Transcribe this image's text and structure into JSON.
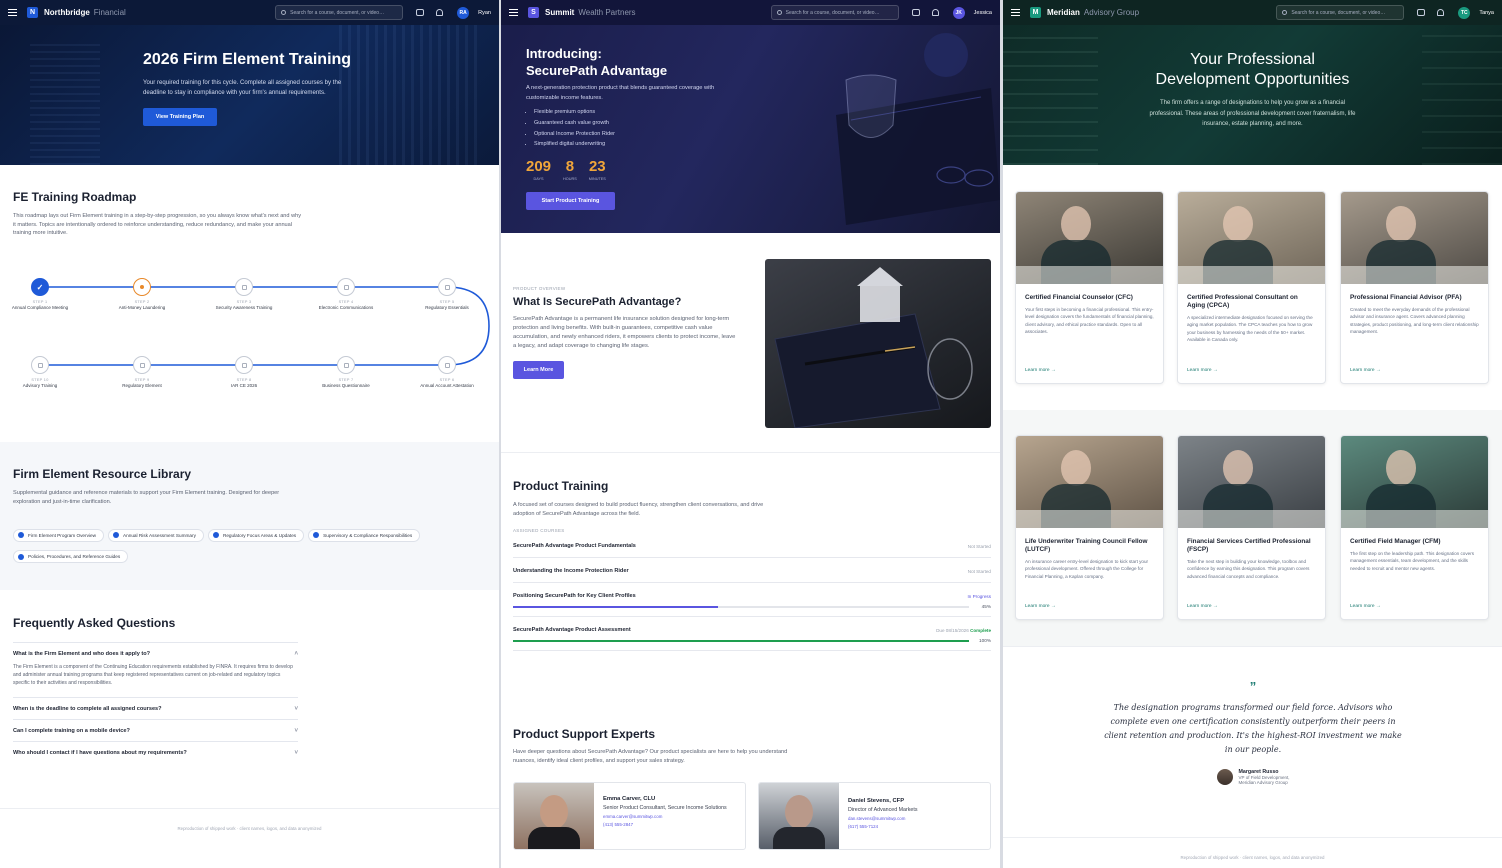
{
  "p1": {
    "topbar": {
      "logo": "N",
      "brand": "Northbridge",
      "brand_sub": "Financial",
      "search_placeholder": "Search for a course, document, or video…",
      "avatar": "RA",
      "user": "Ryan"
    },
    "hero": {
      "title": "2026 Firm Element Training",
      "text": "Your required training for this cycle. Complete all assigned courses by the deadline to stay in compliance with your firm's annual requirements.",
      "button": "View Training Plan"
    },
    "roadmap": {
      "title": "FE Training Roadmap",
      "text": "This roadmap lays out Firm Element training in a step-by-step progression, so you always know what's next and why it matters. Topics are intentionally ordered to reinforce understanding, reduce redundancy, and make your annual training more intuitive.",
      "steps": [
        {
          "step": "STEP 1",
          "name": "Annual Compliance Meeting",
          "status": "complete"
        },
        {
          "step": "STEP 2",
          "name": "Anti-Money Laundering",
          "status": "current"
        },
        {
          "step": "STEP 3",
          "name": "Security Awareness Training",
          "status": "locked"
        },
        {
          "step": "STEP 4",
          "name": "Electronic Communications",
          "status": "locked"
        },
        {
          "step": "STEP 5",
          "name": "Regulatory Essentials",
          "status": "locked"
        },
        {
          "step": "STEP 6",
          "name": "Annual Account Attestation",
          "status": "locked"
        },
        {
          "step": "STEP 7",
          "name": "Business Questionnaire",
          "status": "locked"
        },
        {
          "step": "STEP 8",
          "name": "IAR CE 2026",
          "status": "locked"
        },
        {
          "step": "STEP 9",
          "name": "Regulatory Element",
          "status": "locked"
        },
        {
          "step": "STEP 10",
          "name": "Advisory Training",
          "status": "locked"
        }
      ]
    },
    "library": {
      "title": "Firm Element Resource Library",
      "text": "Supplemental guidance and reference materials to support your Firm Element training. Designed for deeper exploration and just-in-time clarification.",
      "items": [
        "Firm Element Program Overview",
        "Annual Risk Assessment Summary",
        "Regulatory Focus Areas & Updates",
        "Supervisory & Compliance Responsibilities",
        "Policies, Procedures, and Reference Guides"
      ]
    },
    "faq": {
      "title": "Frequently Asked Questions",
      "items": [
        {
          "q": "What is the Firm Element and who does it apply to?",
          "a": "The Firm Element is a component of the Continuing Education requirements established by FINRA. It requires firms to develop and administer annual training programs that keep registered representatives current on job-related and regulatory topics specific to their activities and responsibilities."
        },
        {
          "q": "When is the deadline to complete all assigned courses?"
        },
        {
          "q": "Can I complete training on a mobile device?"
        },
        {
          "q": "Who should I contact if I have questions about my requirements?"
        }
      ]
    },
    "footer": "Reproduction of shipped work · client names, logos, and data anonymized"
  },
  "p2": {
    "topbar": {
      "logo": "S",
      "brand": "Summit",
      "brand_sub": "Wealth Partners",
      "search_placeholder": "Search for a course, document, or video…",
      "avatar": "JK",
      "user": "Jessica"
    },
    "hero": {
      "title_1": "Introducing:",
      "title_2": "SecurePath Advantage",
      "text": "A next-generation protection product that blends guaranteed coverage with customizable income features.",
      "bullets": [
        "Flexible premium options",
        "Guaranteed cash value growth",
        "Optional Income Protection Rider",
        "Simplified digital underwriting"
      ],
      "countdown": [
        {
          "value": "209",
          "label": "DAYS"
        },
        {
          "value": "8",
          "label": "HOURS"
        },
        {
          "value": "23",
          "label": "MINUTES"
        }
      ],
      "button": "Start Product Training"
    },
    "overview": {
      "eyebrow": "PRODUCT OVERVIEW",
      "title": "What Is SecurePath Advantage?",
      "text": "SecurePath Advantage is a permanent life insurance solution designed for long-term protection and living benefits. With built-in guarantees, competitive cash value accumulation, and newly enhanced riders, it empowers clients to protect income, leave a legacy, and adapt coverage to changing life stages.",
      "button": "Learn More"
    },
    "training": {
      "title": "Product Training",
      "text": "A focused set of courses designed to build product fluency, strengthen client conversations, and drive adoption of SecurePath Advantage across the field.",
      "label": "ASSIGNED COURSES",
      "courses": [
        {
          "name": "SecurePath Advantage Product Fundamentals",
          "status": "Not Started"
        },
        {
          "name": "Understanding the Income Protection Rider",
          "status": "Not Started"
        },
        {
          "name": "Positioning SecurePath for Key Client Profiles",
          "status": "In Progress",
          "progress": 45,
          "pct": "45%"
        },
        {
          "name": "SecurePath Advantage Product Assessment",
          "due": "Due 08/15/2026",
          "status": "Complete",
          "progress": 100,
          "pct": "100%"
        }
      ]
    },
    "experts": {
      "title": "Product Support Experts",
      "text": "Have deeper questions about SecurePath Advantage? Our product specialists are here to help you understand nuances, identify ideal client profiles, and support your sales strategy.",
      "people": [
        {
          "name": "Emma Carver, CLU",
          "role": "Senior Product Consultant, Secure Income Solutions",
          "email": "emma.carver@summitwp.com",
          "phone": "(413) 555-2847"
        },
        {
          "name": "Daniel Stevens, CFP",
          "role": "Director of Advanced Markets",
          "email": "dan.stevens@summitwp.com",
          "phone": "(617) 555-7124"
        }
      ]
    }
  },
  "p3": {
    "topbar": {
      "logo": "M",
      "brand": "Meridian",
      "brand_sub": "Advisory Group",
      "search_placeholder": "Search for a course, document, or video…",
      "avatar": "TC",
      "user": "Tanya"
    },
    "hero": {
      "title_1": "Your Professional",
      "title_2": "Development Opportunities",
      "text": "The firm offers a range of designations to help you grow as a financial professional. These areas of professional development cover fraternalism, life insurance, estate planning, and more."
    },
    "cards": [
      {
        "title": "Certified Financial Counselor (CFC)",
        "desc": "Your first steps in becoming a financial professional. This entry-level designation covers the fundamentals of financial planning, client advisory, and ethical practice standards. Open to all associates.",
        "link": "Learn more →"
      },
      {
        "title": "Certified Professional Consultant on Aging (CPCA)",
        "desc": "A specialized intermediate designation focused on serving the aging market population. The CPCA teaches you how to grow your business by harnessing the needs of the 50+ market. Available in Canada only.",
        "link": "Learn more →"
      },
      {
        "title": "Professional Financial Advisor (PFA)",
        "desc": "Created to meet the everyday demands of the professional advisor and insurance agent. Covers advanced planning strategies, product positioning, and long-term client relationship management.",
        "link": "Learn more →"
      },
      {
        "title": "Life Underwriter Training Council Fellow (LUTCF)",
        "desc": "An insurance career entry-level designation to kick start your professional development. Offered through the College for Financial Planning, a Kaplan company.",
        "link": "Learn more →"
      },
      {
        "title": "Financial Services Certified Professional (FSCP)",
        "desc": "Take the next step in building your knowledge, toolbox and confidence by earning this designation. This program covers advanced financial concepts and compliance.",
        "link": "Learn more →"
      },
      {
        "title": "Certified Field Manager (CFM)",
        "desc": "The first step on the leadership path. This designation covers management essentials, team development, and the skills needed to recruit and mentor new agents.",
        "link": "Learn more →"
      }
    ],
    "quote": {
      "mark": "”",
      "text": "The designation programs transformed our field force. Advisors who complete even one certification consistently outperform their peers in client retention and production. It's the highest-ROI investment we make in our people.",
      "name": "Margaret Russo",
      "title": "VP of Field Development,",
      "org": "Meridian Advisory Group"
    },
    "footer": "Reproduction of shipped work · client names, logos, and data anonymized"
  },
  "colors": {
    "nb_blue": "#1f5ad8",
    "nb_orange": "#e8892a",
    "sm_indigo": "#5a55e0",
    "sm_green": "#1e9e4f",
    "mr_teal": "#1a7a70"
  }
}
